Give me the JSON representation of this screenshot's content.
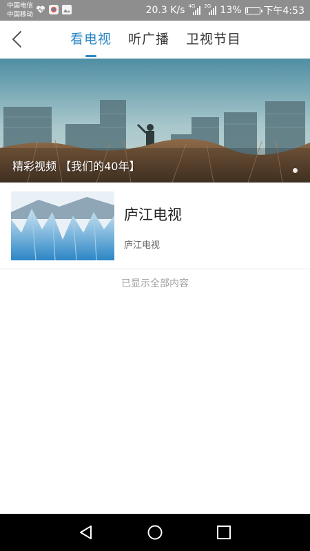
{
  "status_bar": {
    "carrier_1": "中国电信",
    "carrier_2": "中国移动",
    "net_speed": "20.3 K/s",
    "sig1_tag": "4G",
    "sig2_tag": "2G",
    "battery": "13%",
    "battery_level": 0.13,
    "time": "下午4:53",
    "icons": [
      "heart-monitor-icon",
      "app-icon",
      "gallery-icon"
    ]
  },
  "header": {
    "back_icon": "back-arrow-icon",
    "tabs": [
      {
        "label": "看电视",
        "active": true
      },
      {
        "label": "听广播",
        "active": false
      },
      {
        "label": "卫视节目",
        "active": false
      }
    ],
    "accent_color": "#2c86c6"
  },
  "banner": {
    "caption": "精彩视频 【我们的40年】",
    "pages": 1,
    "current_page": 1
  },
  "list": [
    {
      "title": "庐江电视",
      "subtitle": "庐江电视"
    }
  ],
  "footer_note": "已显示全部内容",
  "nav_bar": {
    "back_icon": "back-triangle-icon",
    "home_icon": "home-circle-icon",
    "recents_icon": "recents-square-icon"
  }
}
